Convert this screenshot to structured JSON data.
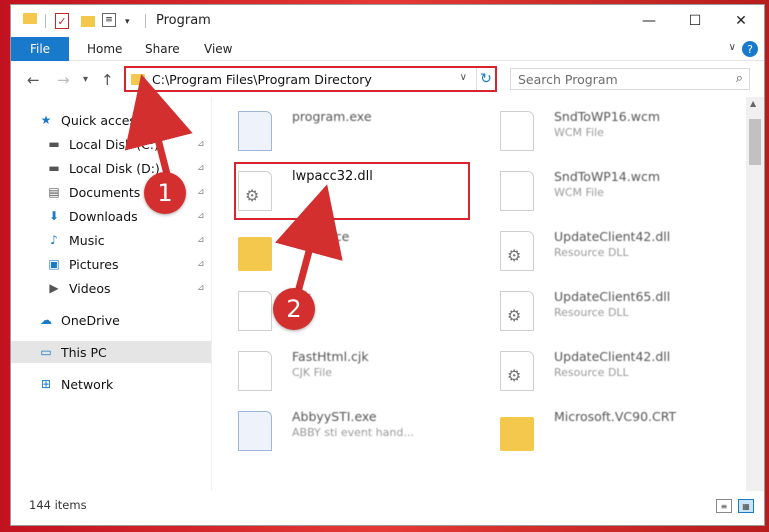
{
  "window": {
    "title": "Program",
    "controls": {
      "minimize": "—",
      "maximize": "☐",
      "close": "✕"
    }
  },
  "ribbon": {
    "tabs": [
      "File",
      "Home",
      "Share",
      "View"
    ],
    "expand_icon": "chevron-down-icon",
    "help_icon": "help-icon"
  },
  "toolbar": {
    "back": "←",
    "forward": "→",
    "recent": "▾",
    "up": "↑",
    "address": "C:\\Program Files\\Program Directory",
    "refresh": "↻",
    "search_placeholder": "Search Program",
    "search_icon": "⌕"
  },
  "nav": {
    "items": [
      {
        "label": "Quick access",
        "icon": "star-icon",
        "glyph": "★",
        "color": "#1979ca"
      },
      {
        "label": "Local Disk (C:)",
        "icon": "drive-icon",
        "glyph": "▬",
        "color": "#555555",
        "pinned": true
      },
      {
        "label": "Local Disk (D:)",
        "icon": "drive-icon",
        "glyph": "▬",
        "color": "#555555",
        "pinned": true
      },
      {
        "label": "Documents",
        "icon": "documents-icon",
        "glyph": "▤",
        "color": "#555555",
        "pinned": true
      },
      {
        "label": "Downloads",
        "icon": "downloads-icon",
        "glyph": "⬇",
        "color": "#1979ca",
        "pinned": true
      },
      {
        "label": "Music",
        "icon": "music-icon",
        "glyph": "♪",
        "color": "#1979ca",
        "pinned": true
      },
      {
        "label": "Pictures",
        "icon": "pictures-icon",
        "glyph": "▣",
        "color": "#1979ca",
        "pinned": true
      },
      {
        "label": "Videos",
        "icon": "videos-icon",
        "glyph": "▶",
        "color": "#555555",
        "pinned": true
      },
      {
        "label": "OneDrive",
        "icon": "cloud-icon",
        "glyph": "☁",
        "color": "#1979ca"
      },
      {
        "label": "This PC",
        "icon": "computer-icon",
        "glyph": "▭",
        "color": "#1979ca",
        "selected": true
      },
      {
        "label": "Network",
        "icon": "network-icon",
        "glyph": "⊞",
        "color": "#1979ca"
      }
    ],
    "pin_glyph": "📌"
  },
  "files": {
    "left": [
      {
        "name": "program.exe",
        "sub": "",
        "kind": "exe"
      },
      {
        "name": "lwpacc32.dll",
        "sub": "",
        "kind": "dll",
        "highlight": true
      },
      {
        "name": "Resource",
        "sub": "",
        "kind": "folder"
      },
      {
        "name": "...k",
        "sub": "",
        "kind": "doc"
      },
      {
        "name": "FastHtml.cjk",
        "sub": "CJK File",
        "kind": "doc"
      },
      {
        "name": "AbbyySTI.exe",
        "sub": "ABBY sti event hand...",
        "kind": "exe"
      }
    ],
    "right": [
      {
        "name": "SndToWP16.wcm",
        "sub": "WCM File",
        "kind": "doc"
      },
      {
        "name": "SndToWP14.wcm",
        "sub": "WCM File",
        "kind": "doc"
      },
      {
        "name": "UpdateClient42.dll",
        "sub": "Resource DLL",
        "kind": "dll"
      },
      {
        "name": "UpdateClient65.dll",
        "sub": "Resource DLL",
        "kind": "dll"
      },
      {
        "name": "UpdateClient42.dll",
        "sub": "Resource DLL",
        "kind": "dll"
      },
      {
        "name": "Microsoft.VC90.CRT",
        "sub": "",
        "kind": "folder"
      }
    ]
  },
  "status": {
    "count": "144 items"
  },
  "annotations": {
    "badge1": "1",
    "badge2": "2",
    "color": "#d9232e"
  }
}
